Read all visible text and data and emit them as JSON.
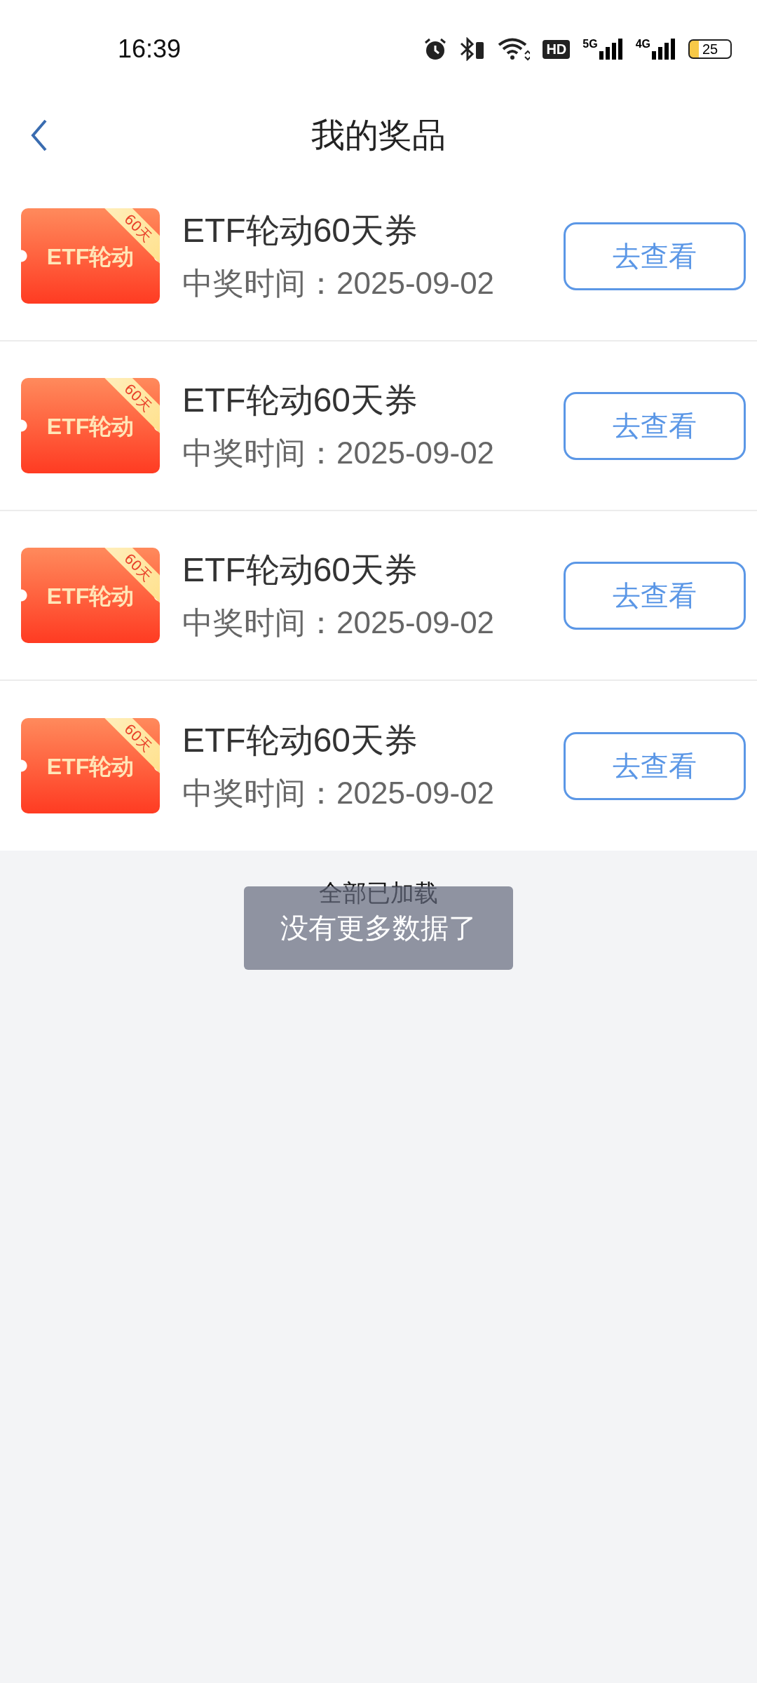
{
  "status_bar": {
    "time": "16:39",
    "hd": "HD",
    "network_5g": "5G",
    "network_4g": "4G",
    "battery": "25"
  },
  "header": {
    "title": "我的奖品"
  },
  "prizes": [
    {
      "badge": "ETF轮动",
      "corner": "60天",
      "title": "ETF轮动60天券",
      "date": "中奖时间：2025-09-02",
      "button": "去查看"
    },
    {
      "badge": "ETF轮动",
      "corner": "60天",
      "title": "ETF轮动60天券",
      "date": "中奖时间：2025-09-02",
      "button": "去查看"
    },
    {
      "badge": "ETF轮动",
      "corner": "60天",
      "title": "ETF轮动60天券",
      "date": "中奖时间：2025-09-02",
      "button": "去查看"
    },
    {
      "badge": "ETF轮动",
      "corner": "60天",
      "title": "ETF轮动60天券",
      "date": "中奖时间：2025-09-02",
      "button": "去查看"
    }
  ],
  "footer": "全部已加载",
  "toast": "没有更多数据了"
}
